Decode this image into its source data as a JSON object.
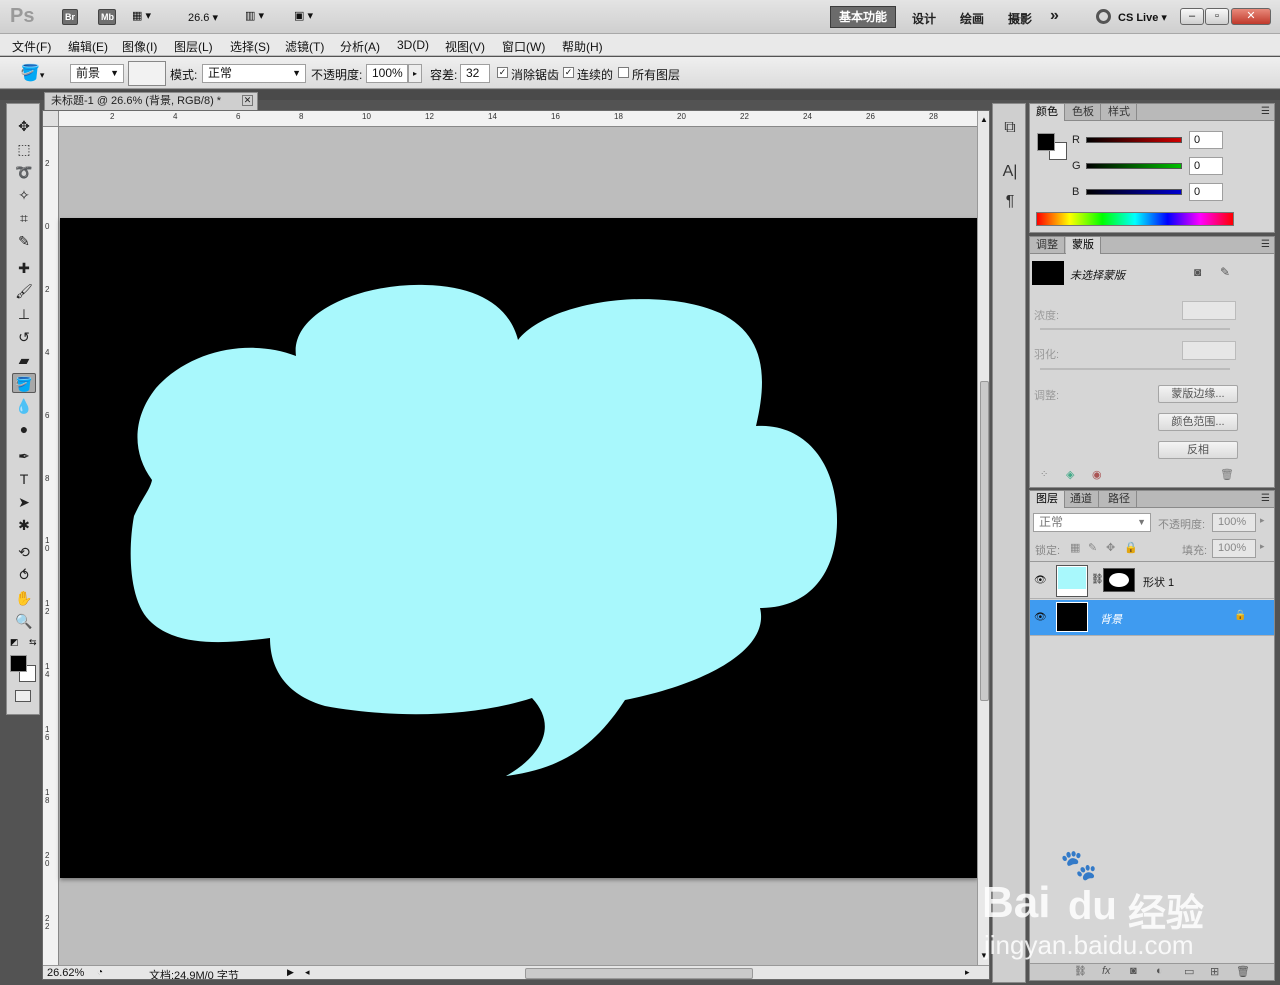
{
  "app": {
    "logo": "Ps",
    "bridge": "Br",
    "minibridge": "Mb",
    "zoom_value": "26.6",
    "workspaces": [
      "基本功能",
      "设计",
      "绘画",
      "摄影"
    ],
    "more": "»",
    "cs_live": "CS Live"
  },
  "menu": [
    "文件(F)",
    "编辑(E)",
    "图像(I)",
    "图层(L)",
    "选择(S)",
    "滤镜(T)",
    "分析(A)",
    "3D(D)",
    "视图(V)",
    "窗口(W)",
    "帮助(H)"
  ],
  "options": {
    "fill_source": "前景",
    "mode_label": "模式:",
    "mode_value": "正常",
    "opacity_label": "不透明度:",
    "opacity_value": "100%",
    "tolerance_label": "容差:",
    "tolerance_value": "32",
    "antialias": "消除锯齿",
    "contiguous": "连续的",
    "all_layers": "所有图层"
  },
  "document": {
    "tab_title": "未标题-1 @ 26.6% (背景, RGB/8) *",
    "ruler_h": [
      "2",
      "4",
      "6",
      "8",
      "10",
      "12",
      "14",
      "16",
      "18",
      "20",
      "22",
      "24",
      "26",
      "28"
    ],
    "ruler_v": [
      "2",
      "0",
      "2",
      "4",
      "6",
      "8",
      "1\n0",
      "1\n2",
      "1\n4",
      "1\n6",
      "1\n8",
      "2\n0",
      "2\n2"
    ],
    "shape_color": "#a8f8fc",
    "canvas_color": "#000000",
    "status_zoom": "26.62%",
    "status_doc": "文档:24.9M/0 字节"
  },
  "color_panel": {
    "tabs": [
      "颜色",
      "色板",
      "样式"
    ],
    "channels": [
      {
        "label": "R",
        "value": "0",
        "color": "#d00000"
      },
      {
        "label": "G",
        "value": "0",
        "color": "#00c000"
      },
      {
        "label": "B",
        "value": "0",
        "color": "#0000d0"
      }
    ]
  },
  "masks_panel": {
    "tabs": [
      "调整",
      "蒙版"
    ],
    "status": "未选择蒙版",
    "density_label": "浓度:",
    "feather_label": "羽化:",
    "refine_label": "调整:",
    "buttons": [
      "蒙版边缘...",
      "颜色范围...",
      "反相"
    ]
  },
  "layers_panel": {
    "tabs": [
      "图层",
      "通道",
      "路径"
    ],
    "blend_mode": "正常",
    "opacity_label": "不透明度:",
    "opacity_value": "100%",
    "lock_label": "锁定:",
    "fill_label": "填充:",
    "fill_value": "100%",
    "layers": [
      {
        "name": "形状 1",
        "thumb_color": "#a8f8fc",
        "selected": false
      },
      {
        "name": "背景",
        "thumb_color": "#000000",
        "selected": true
      }
    ]
  },
  "watermark": {
    "brand": "Bai",
    "brand2": "du",
    "cn": "经验",
    "url": "jingyan.baidu.com"
  }
}
